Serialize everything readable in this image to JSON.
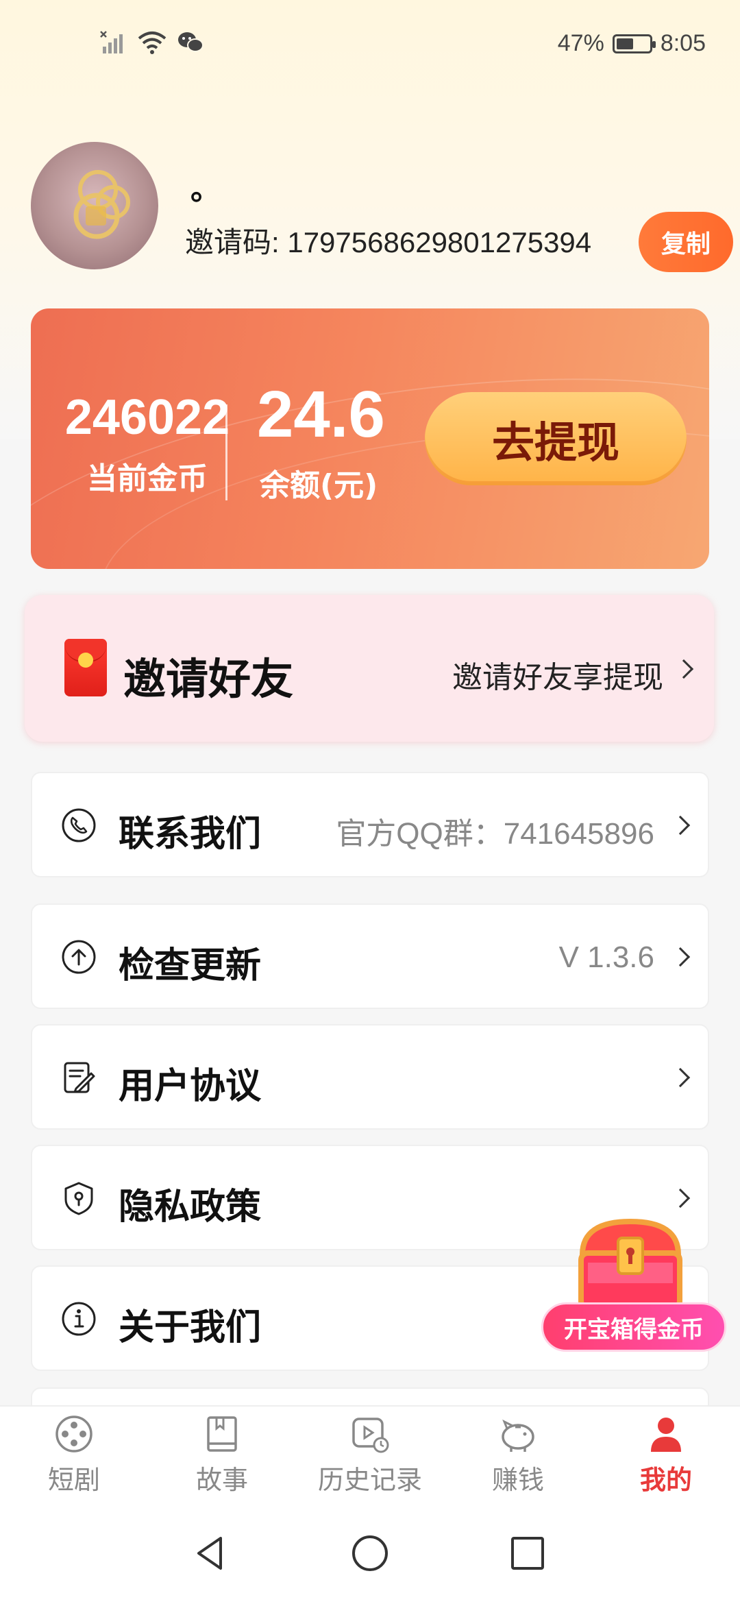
{
  "status_bar": {
    "battery_percent": "47%",
    "battery_level": 0.47,
    "time": "8:05",
    "icons": [
      "no-signal-icon",
      "wifi-icon",
      "wechat-icon"
    ]
  },
  "profile": {
    "username": "。",
    "invite_label": "邀请码: ",
    "invite_code": "1797568629801275394",
    "copy_label": "复制"
  },
  "balance": {
    "coins_value": "246022",
    "coins_label": "当前金币",
    "money_value": "24.6",
    "money_label": "余额(元)",
    "withdraw_label": "去提现"
  },
  "invite_card": {
    "title": "邀请好友",
    "subtitle": "邀请好友享提现"
  },
  "menu": [
    {
      "label": "联系我们",
      "value": "官方QQ群：741645896",
      "icon": "phone-icon"
    },
    {
      "label": "检查更新",
      "value": "V 1.3.6",
      "icon": "upload-icon"
    },
    {
      "label": "用户协议",
      "value": "",
      "icon": "document-edit-icon"
    },
    {
      "label": "隐私政策",
      "value": "",
      "icon": "shield-icon"
    },
    {
      "label": "关于我们",
      "value": "",
      "icon": "info-icon"
    }
  ],
  "treasure": {
    "label": "开宝箱得金币"
  },
  "bottom_nav": [
    {
      "label": "短剧",
      "icon": "film-reel-icon",
      "active": false
    },
    {
      "label": "故事",
      "icon": "book-icon",
      "active": false
    },
    {
      "label": "历史记录",
      "icon": "history-play-icon",
      "active": false
    },
    {
      "label": "赚钱",
      "icon": "piggy-bank-icon",
      "active": false
    },
    {
      "label": "我的",
      "icon": "user-icon",
      "active": true
    }
  ],
  "colors": {
    "accent": "#ff6a2c",
    "active_tab": "#e83a3a",
    "card_start": "#ee6e52",
    "card_end": "#f7a772",
    "invite_bg": "#fde8ec"
  }
}
